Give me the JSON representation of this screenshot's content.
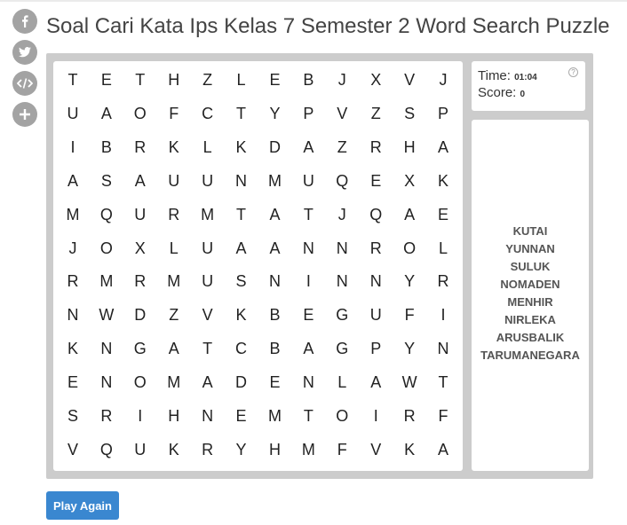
{
  "title": "Soal Cari Kata Ips Kelas 7 Semester 2 Word Search Puzzle",
  "share": [
    {
      "name": "facebook-icon"
    },
    {
      "name": "twitter-icon"
    },
    {
      "name": "embed-icon"
    },
    {
      "name": "plus-icon"
    }
  ],
  "grid": [
    [
      "T",
      "E",
      "T",
      "H",
      "Z",
      "L",
      "E",
      "B",
      "J",
      "X",
      "V",
      "J"
    ],
    [
      "U",
      "A",
      "O",
      "F",
      "C",
      "T",
      "Y",
      "P",
      "V",
      "Z",
      "S",
      "P"
    ],
    [
      "I",
      "B",
      "R",
      "K",
      "L",
      "K",
      "D",
      "A",
      "Z",
      "R",
      "H",
      "A"
    ],
    [
      "A",
      "S",
      "A",
      "U",
      "U",
      "N",
      "M",
      "U",
      "Q",
      "E",
      "X",
      "K"
    ],
    [
      "M",
      "Q",
      "U",
      "R",
      "M",
      "T",
      "A",
      "T",
      "J",
      "Q",
      "A",
      "E"
    ],
    [
      "J",
      "O",
      "X",
      "L",
      "U",
      "A",
      "A",
      "N",
      "N",
      "R",
      "O",
      "L"
    ],
    [
      "R",
      "M",
      "R",
      "M",
      "U",
      "S",
      "N",
      "I",
      "N",
      "N",
      "Y",
      "R"
    ],
    [
      "N",
      "W",
      "D",
      "Z",
      "V",
      "K",
      "B",
      "E",
      "G",
      "U",
      "F",
      "I"
    ],
    [
      "K",
      "N",
      "G",
      "A",
      "T",
      "C",
      "B",
      "A",
      "G",
      "P",
      "Y",
      "N"
    ],
    [
      "E",
      "N",
      "O",
      "M",
      "A",
      "D",
      "E",
      "N",
      "L",
      "A",
      "W",
      "T"
    ],
    [
      "S",
      "R",
      "I",
      "H",
      "N",
      "E",
      "M",
      "T",
      "O",
      "I",
      "R",
      "F"
    ],
    [
      "V",
      "Q",
      "U",
      "K",
      "R",
      "Y",
      "H",
      "M",
      "F",
      "V",
      "K",
      "A"
    ]
  ],
  "status": {
    "time_label": "Time:",
    "time_value": "01:04",
    "score_label": "Score:",
    "score_value": "0",
    "help": "?"
  },
  "words": [
    "KUTAI",
    "YUNNAN",
    "SULUK",
    "NOMADEN",
    "MENHIR",
    "NIRLEKA",
    "ARUSBALIK",
    "TARUMANEGARA"
  ],
  "play_again_label": "Play Again",
  "colors": {
    "board": "#cccccc",
    "button": "#3a87d0",
    "share": "#a3a3a3"
  }
}
